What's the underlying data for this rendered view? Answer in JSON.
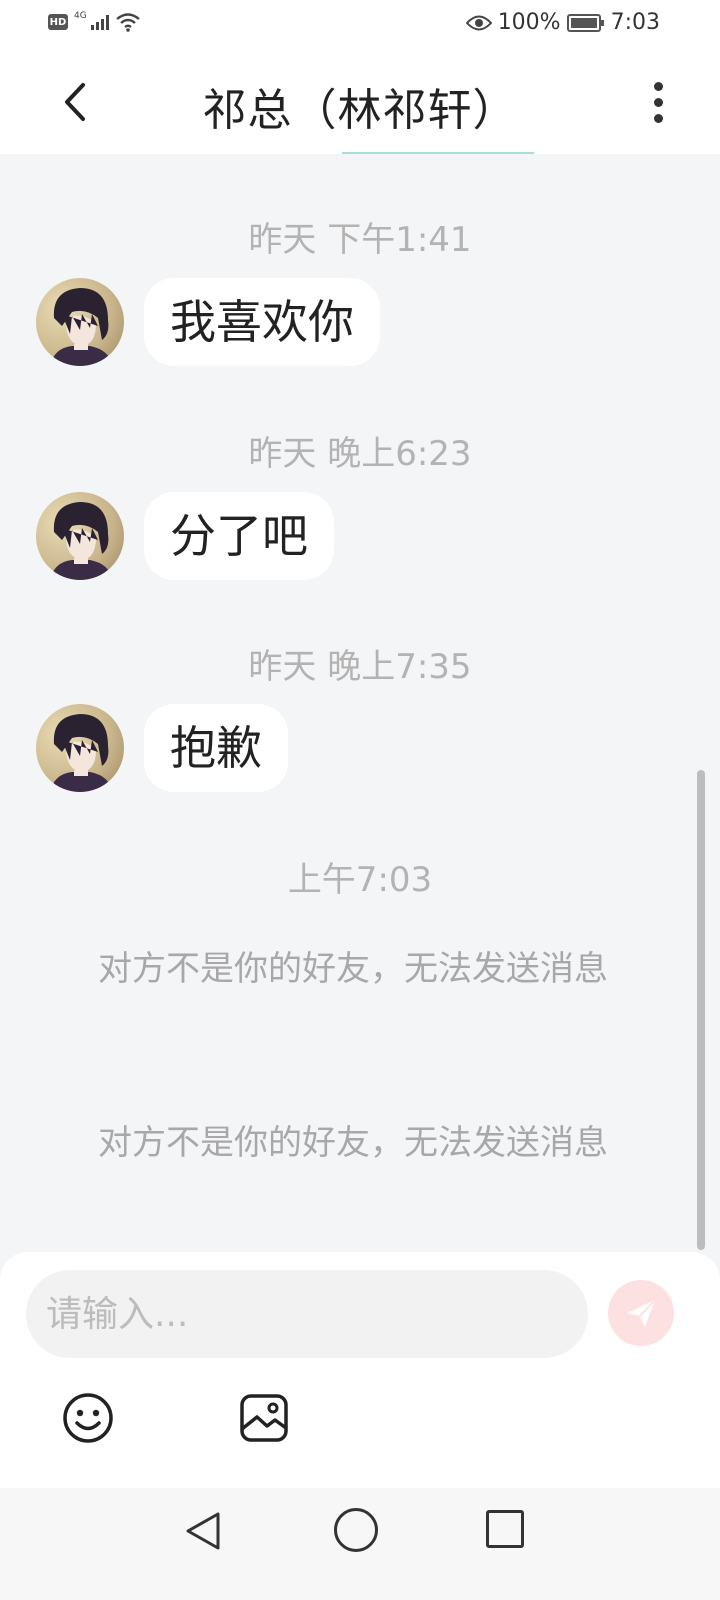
{
  "status_bar": {
    "hd": "HD",
    "network": "4G",
    "battery": "100%",
    "time": "7:03"
  },
  "header": {
    "title": "祁总（林祁轩）"
  },
  "messages": [
    {
      "timestamp": "昨天 下午1:41",
      "text": "我喜欢你"
    },
    {
      "timestamp": "昨天 晚上6:23",
      "text": "分了吧"
    },
    {
      "timestamp": "昨天 晚上7:35",
      "text": "抱歉"
    }
  ],
  "system": {
    "timestamp": "上午7:03",
    "notices": [
      "对方不是你的好友，无法发送消息",
      "对方不是你的好友，无法发送消息"
    ]
  },
  "input": {
    "placeholder": "请输入...",
    "value": ""
  },
  "icons": {
    "back": "chevron-left-icon",
    "more": "more-vertical-icon",
    "send": "paper-plane-icon",
    "emoji": "smiley-icon",
    "image": "image-icon"
  },
  "colors": {
    "background": "#f4f5f7",
    "bubble": "#ffffff",
    "timestamp_text": "#b3b3b3",
    "send_button": "#fde1e1"
  }
}
